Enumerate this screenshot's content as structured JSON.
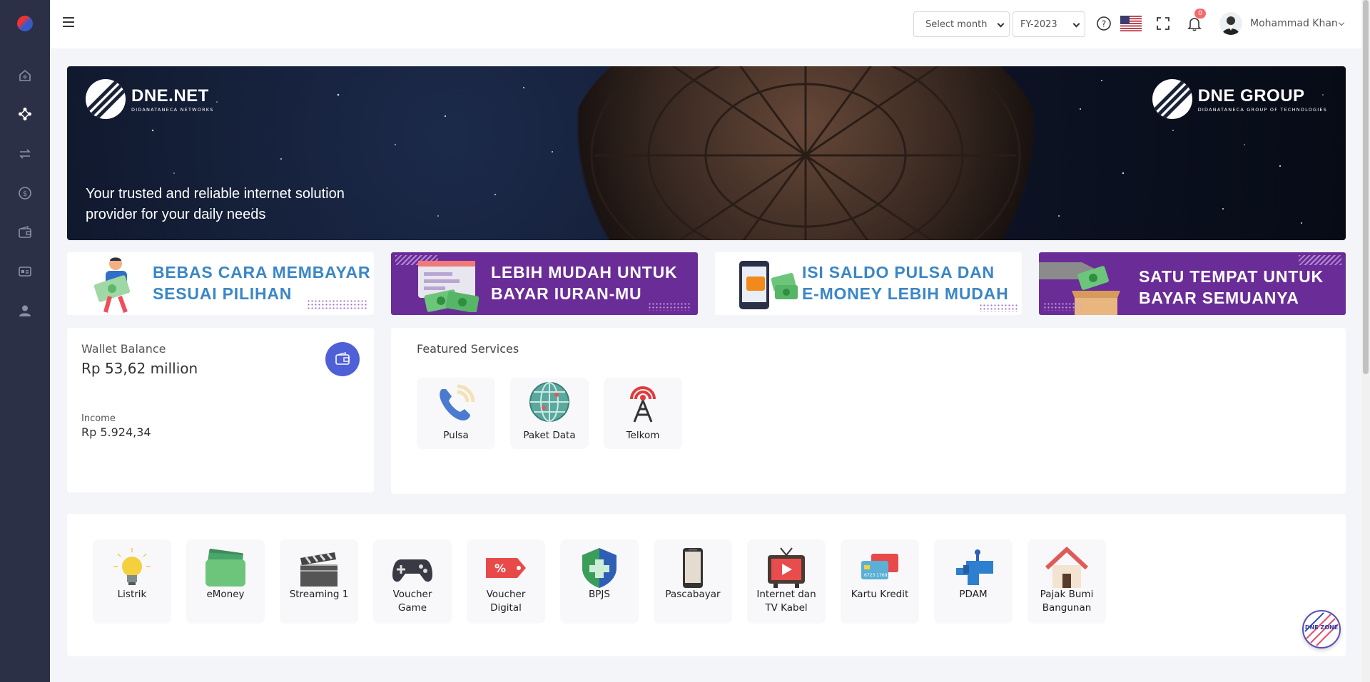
{
  "topbar": {
    "month_select": "Select month",
    "year_select": "FY-2023",
    "notification_count": "0",
    "user_name": "Mohammad Khan"
  },
  "sidebar": {
    "items": [
      {
        "icon": "home-icon"
      },
      {
        "icon": "apps-icon"
      },
      {
        "icon": "transfer-icon"
      },
      {
        "icon": "dollar-icon"
      },
      {
        "icon": "wallet-icon"
      },
      {
        "icon": "id-card-icon"
      },
      {
        "icon": "user-icon"
      }
    ]
  },
  "hero": {
    "left_brand": "DNE.NET",
    "left_brand_sub": "DIDANATANECA NETWORKS",
    "right_brand": "DNE GROUP",
    "right_brand_sub": "DIDANATANECA GROUP OF TECHNOLOGIES",
    "tagline": "Your trusted and reliable internet solution provider for your daily needs"
  },
  "promos": [
    {
      "line1": "BEBAS CARA MEMBAYAR",
      "line2": "SESUAI PILIHAN"
    },
    {
      "line1": "LEBIH MUDAH UNTUK",
      "line2": "BAYAR IURAN-MU"
    },
    {
      "line1": "ISI SALDO PULSA DAN",
      "line2": "E-MONEY LEBIH MUDAH"
    },
    {
      "line1": "SATU TEMPAT UNTUK",
      "line2": "BAYAR SEMUANYA"
    }
  ],
  "wallet": {
    "label": "Wallet Balance",
    "value": "Rp 53,62 million",
    "income_label": "Income",
    "income_value": "Rp 5.924,34"
  },
  "featured": {
    "title": "Featured Services",
    "items": [
      {
        "label": "Pulsa",
        "icon": "phone-icon"
      },
      {
        "label": "Paket Data",
        "icon": "globe-icon"
      },
      {
        "label": "Telkom",
        "icon": "antenna-icon"
      }
    ]
  },
  "services": [
    {
      "label": "Listrik",
      "icon": "lightbulb-icon"
    },
    {
      "label": "eMoney",
      "icon": "money-wallet-icon"
    },
    {
      "label": "Streaming 1",
      "icon": "clapperboard-icon"
    },
    {
      "label": "Voucher Game",
      "icon": "gamepad-icon"
    },
    {
      "label": "Voucher Digital",
      "icon": "voucher-tag-icon"
    },
    {
      "label": "BPJS",
      "icon": "health-shield-icon"
    },
    {
      "label": "Pascabayar",
      "icon": "smartphone-icon"
    },
    {
      "label": "Internet dan TV Kabel",
      "icon": "tv-icon"
    },
    {
      "label": "Kartu Kredit",
      "icon": "credit-card-icon"
    },
    {
      "label": "PDAM",
      "icon": "water-tap-icon"
    },
    {
      "label": "Pajak Bumi Bangunan",
      "icon": "house-icon"
    }
  ],
  "fab": {
    "label": "DNE ZONE"
  }
}
